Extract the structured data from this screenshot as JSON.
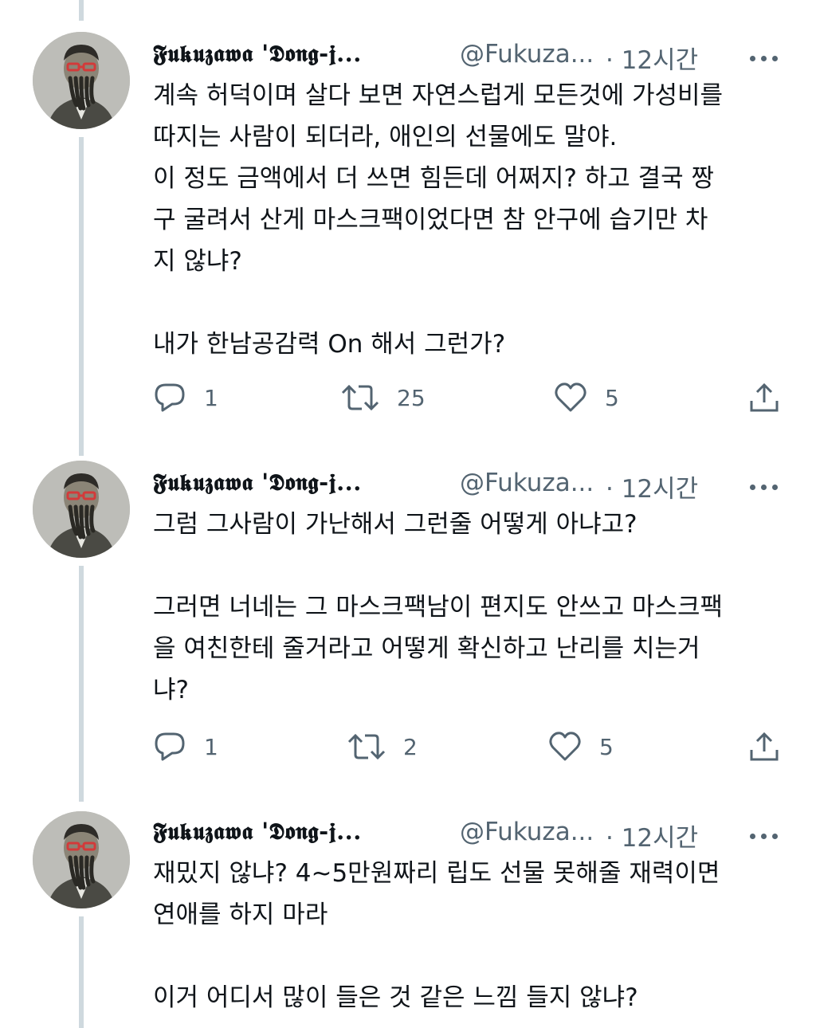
{
  "tweets": [
    {
      "name": "𝕱𝖚𝖐𝖚𝖟𝖆𝖜𝖆 '𝕯𝖔𝖓𝖌-𝖏...",
      "handle": "@Fukuza...",
      "time": "· 12시간",
      "lines": [
        "계속 허덕이며 살다 보면 자연스럽게 모든것에 가성비를",
        "따지는 사람이 되더라, 애인의 선물에도 말야.",
        "이 정도 금액에서 더 쓰면 힘든데 어쩌지? 하고 결국 짱",
        "구 굴려서 산게 마스크팩이었다면 참 안구에 습기만 차",
        "지 않냐?",
        "",
        "내가 한남공감력 On 해서 그런가?"
      ],
      "replies": "1",
      "retweets": "25",
      "likes": "5"
    },
    {
      "name": "𝕱𝖚𝖐𝖚𝖟𝖆𝖜𝖆 '𝕯𝖔𝖓𝖌-𝖏...",
      "handle": "@Fukuza...",
      "time": "· 12시간",
      "lines": [
        "그럼 그사람이 가난해서 그런줄 어떻게 아냐고?",
        "",
        "그러면 너네는 그 마스크팩남이 편지도 안쓰고 마스크팩",
        "을 여친한테 줄거라고 어떻게 확신하고 난리를 치는거",
        "냐?"
      ],
      "replies": "1",
      "retweets": "2",
      "likes": "5"
    },
    {
      "name": "𝕱𝖚𝖐𝖚𝖟𝖆𝖜𝖆 '𝕯𝖔𝖓𝖌-𝖏...",
      "handle": "@Fukuza...",
      "time": "· 12시간",
      "lines": [
        "재밌지 않냐? 4~5만원짜리 립도 선물 못해줄 재력이면",
        "연애를 하지 마라",
        "",
        "이거 어디서 많이 들은 것 같은 느낌 들지 않냐?"
      ]
    }
  ],
  "icons": {
    "reply": "reply-icon",
    "retweet": "retweet-icon",
    "like": "heart-icon",
    "share": "share-icon",
    "more": "more-icon"
  },
  "colors": {
    "text": "#0f1419",
    "secondary": "#536471",
    "thread_line": "#cfd9de"
  }
}
